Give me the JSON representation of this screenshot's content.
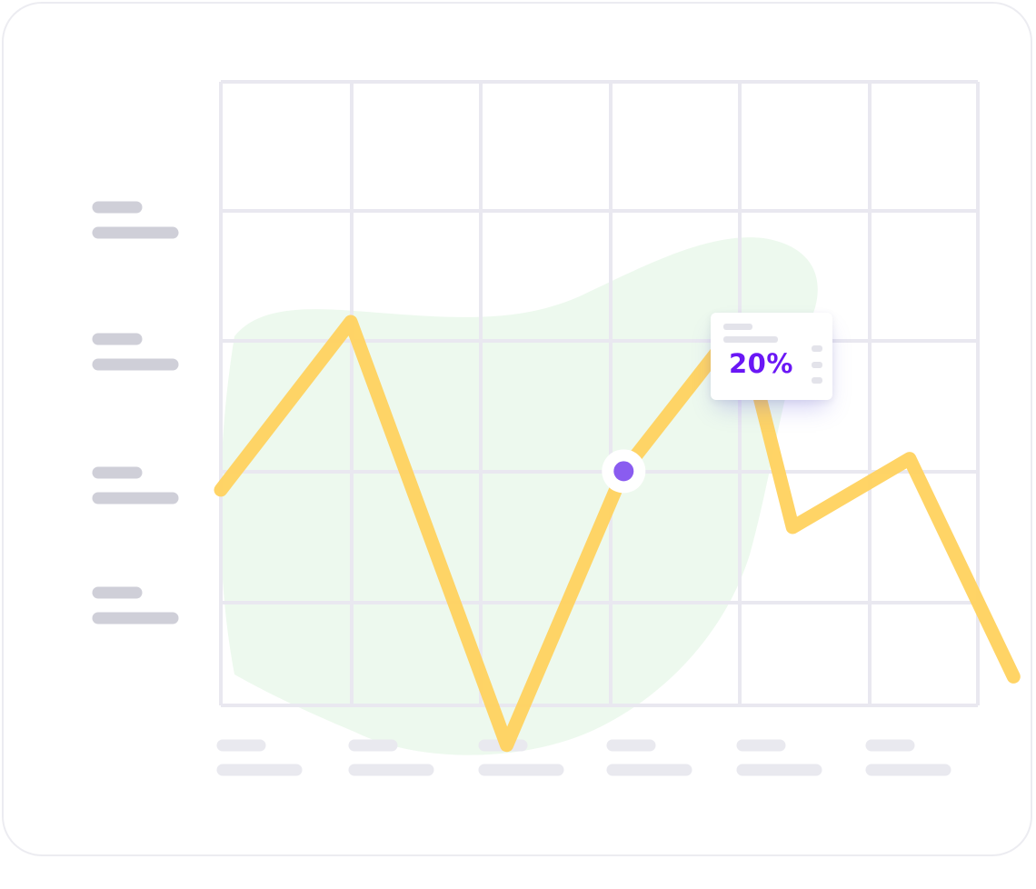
{
  "colors": {
    "line": "#ffd25e",
    "grid": "#e9e8f0",
    "area": "#edf9ee",
    "y_placeholder": "#cfcfd8",
    "x_placeholder": "#e9e9ef",
    "marker": "#8a5cf0",
    "accent_text": "#6a17f5"
  },
  "tooltip": {
    "value_label": "20%"
  },
  "chart_data": {
    "type": "line",
    "title": "",
    "xlabel": "",
    "ylabel": "",
    "grid": true,
    "axis_labels_placeholder": true,
    "x_range": [
      0,
      6
    ],
    "y_range": [
      0,
      100
    ],
    "series": [
      {
        "x": [
          0,
          1,
          2.2,
          3.1,
          4,
          4.4,
          5.3,
          6.1
        ],
        "values": [
          46,
          73,
          5,
          49,
          73,
          40,
          51,
          16
        ]
      }
    ],
    "highlight": {
      "x": 3.1,
      "value": 49,
      "label": "20%"
    }
  }
}
